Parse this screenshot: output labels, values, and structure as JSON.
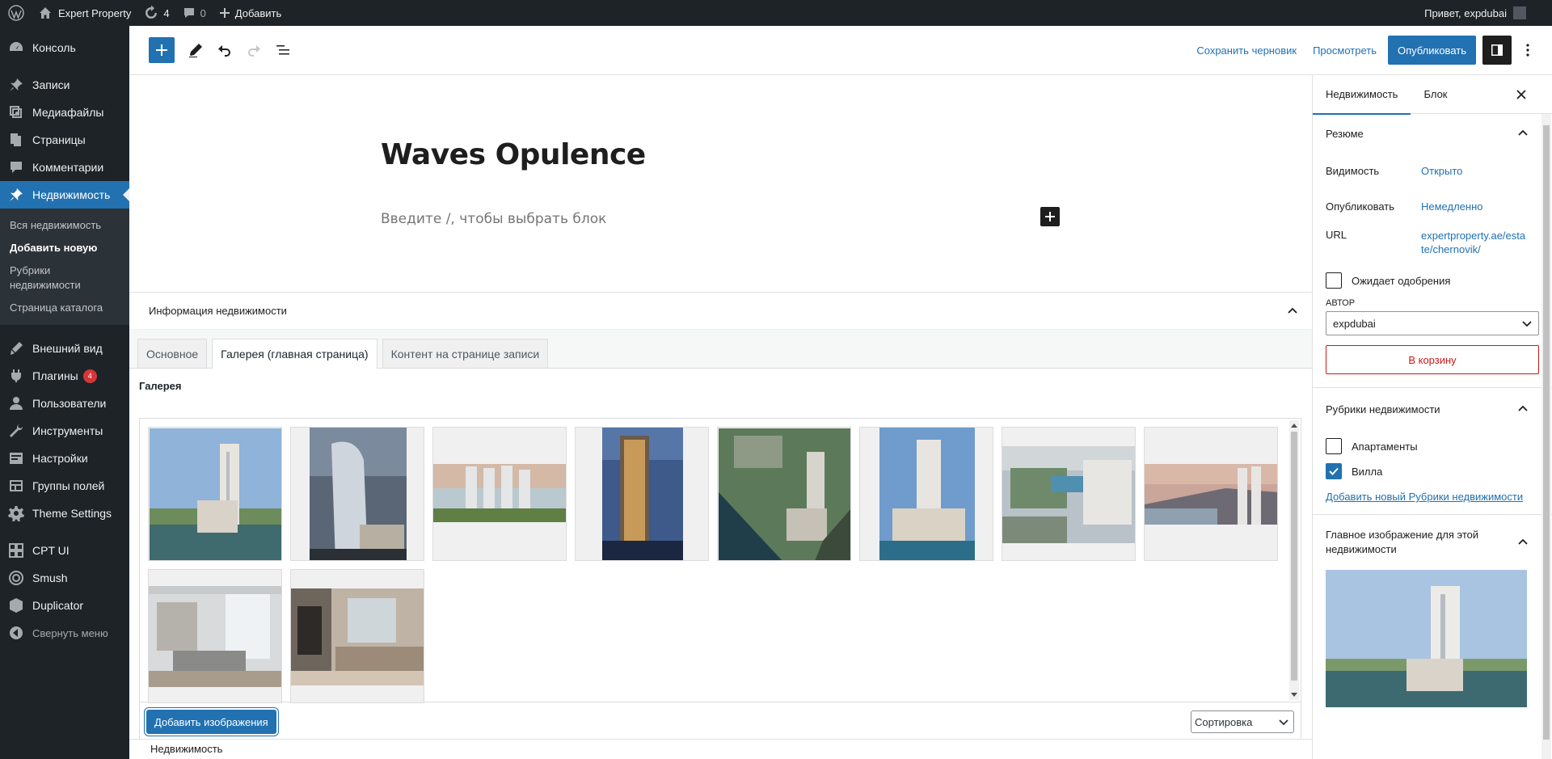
{
  "adminbar": {
    "site_name": "Expert Property",
    "updates_count": "4",
    "comments_count": "0",
    "new_label": "Добавить",
    "greeting": "Привет, expdubai"
  },
  "menu": {
    "items": [
      {
        "label": "Консоль",
        "icon": "dashboard-icon"
      },
      {
        "label": "Записи",
        "icon": "pin-icon"
      },
      {
        "label": "Медиафайлы",
        "icon": "media-icon"
      },
      {
        "label": "Страницы",
        "icon": "pages-icon"
      },
      {
        "label": "Комментарии",
        "icon": "comments-icon"
      },
      {
        "label": "Недвижимость",
        "icon": "pin-icon"
      }
    ],
    "submenu": [
      "Вся недвижимость",
      "Добавить новую",
      "Рубрики недвижимости",
      "Страница каталога"
    ],
    "items2": [
      {
        "label": "Внешний вид",
        "icon": "appearance-icon"
      },
      {
        "label": "Плагины",
        "icon": "plugins-icon",
        "badge": "4"
      },
      {
        "label": "Пользователи",
        "icon": "users-icon"
      },
      {
        "label": "Инструменты",
        "icon": "tools-icon"
      },
      {
        "label": "Настройки",
        "icon": "settings-icon"
      },
      {
        "label": "Группы полей",
        "icon": "fields-icon"
      },
      {
        "label": "Theme Settings",
        "icon": "gear-icon"
      }
    ],
    "items3": [
      {
        "label": "CPT UI",
        "icon": "cpt-icon"
      },
      {
        "label": "Smush",
        "icon": "smush-icon"
      },
      {
        "label": "Duplicator",
        "icon": "duplicator-icon"
      }
    ],
    "collapse": "Свернуть меню"
  },
  "header": {
    "save_draft": "Сохранить черновик",
    "preview": "Просмотреть",
    "publish": "Опубликовать"
  },
  "editor": {
    "title": "Waves Opulence",
    "placeholder": "Введите /, чтобы выбрать блок"
  },
  "metabox": {
    "title": "Информация недвижимости",
    "tabs": [
      "Основное",
      "Галерея (главная страница)",
      "Контент на странице записи"
    ],
    "gallery_label": "Галерея",
    "add_images": "Добавить изображения",
    "sort": "Сортировка"
  },
  "footer": {
    "breadcrumb": "Недвижимость"
  },
  "sidebar": {
    "tabs": [
      "Недвижимость",
      "Блок"
    ],
    "summary": {
      "title": "Резюме",
      "visibility_label": "Видимость",
      "visibility_value": "Открыто",
      "publish_label": "Опубликовать",
      "publish_value": "Немедленно",
      "url_label": "URL",
      "url_value": "expertproperty.ae/estate/chernovik/",
      "pending_label": "Ожидает одобрения",
      "author_label": "АВТОР",
      "author_value": "expdubai",
      "trash": "В корзину"
    },
    "categories": {
      "title": "Рубрики недвижимости",
      "items": [
        {
          "label": "Апартаменты",
          "checked": false
        },
        {
          "label": "Вилла",
          "checked": true
        }
      ],
      "add_new": "Добавить новый Рубрики недвижимости"
    },
    "featured": {
      "title": "Главное изображение для этой недвижимости"
    }
  }
}
